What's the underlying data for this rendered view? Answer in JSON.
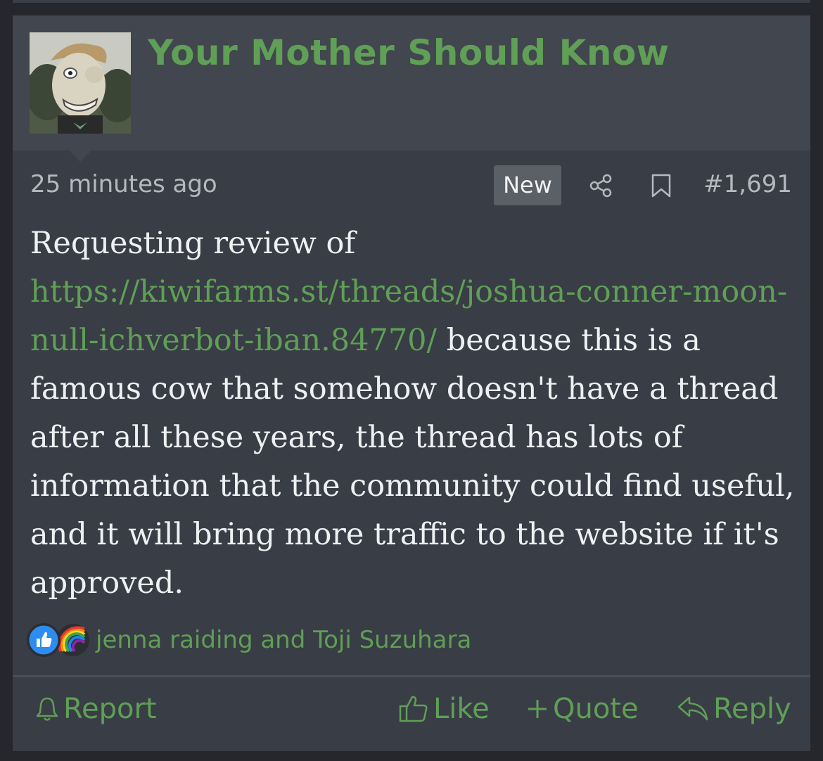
{
  "post": {
    "username": "Your Mother Should Know",
    "time": "25 minutes ago",
    "badge": "New",
    "number": "#1,691",
    "body_intro": "Requesting review of",
    "body_link": "https://kiwifarms.st/threads/joshua-conner-moon-null-ichverbot-iban.84770/",
    "body_rest": " because this is a famous cow that somehow doesn't have a thread after all these years, the thread has lots of information that the community could find useful, and it will bring more traffic to the website if it's approved.",
    "reacted_by": "jenna raiding and Toji Suzuhara",
    "reaction_icons": [
      "thumbs-up-icon",
      "rainbow-icon"
    ]
  },
  "actions": {
    "report": "Report",
    "like": "Like",
    "quote": "Quote",
    "reply": "Reply"
  },
  "colors": {
    "accent": "#5f9f56",
    "card_bg": "#393d45",
    "header_bg": "#42464f",
    "page_bg": "#25272c",
    "text": "#eef0f2",
    "muted": "#b5b9bf"
  }
}
